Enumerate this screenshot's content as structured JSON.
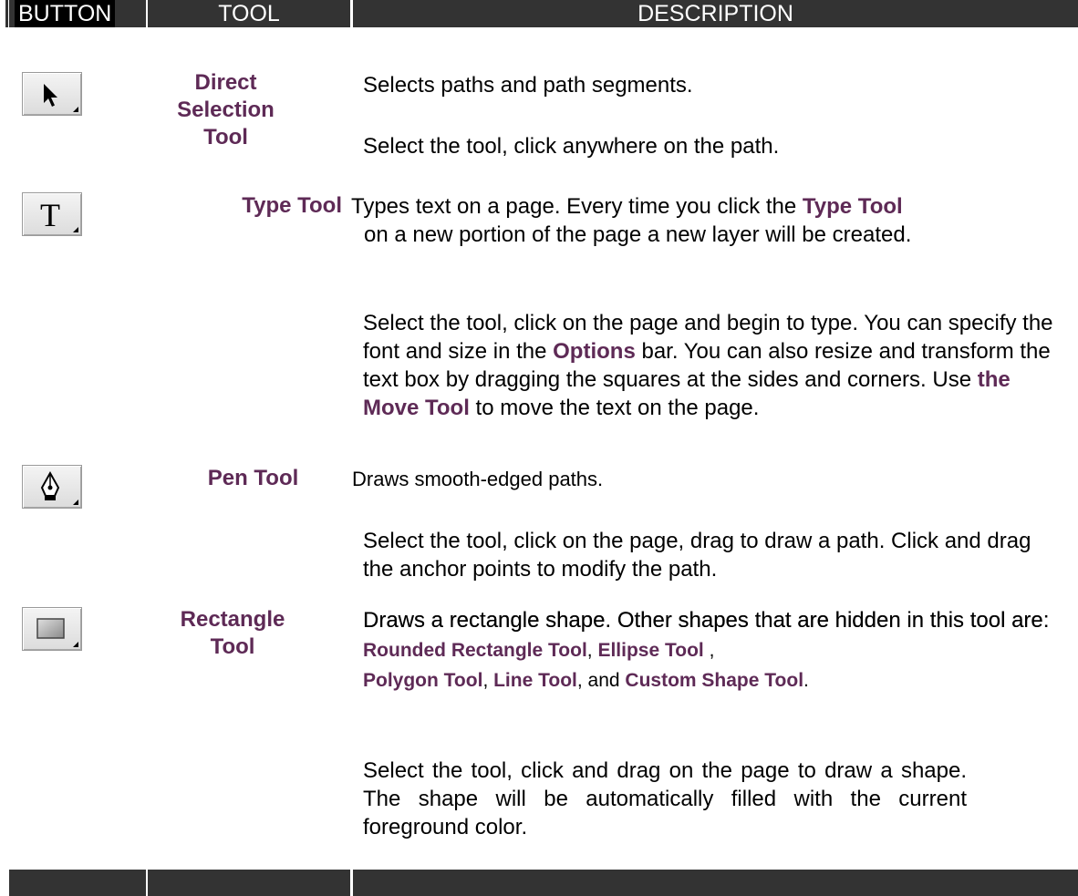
{
  "header": {
    "button_col": "BUTTON",
    "tool_col": "TOOL",
    "description_col": "DESCRIPTION"
  },
  "colors": {
    "header_bg": "#333333",
    "tool_name": "#5e2a56"
  },
  "tools": [
    {
      "icon": "direct-selection-arrow-icon",
      "name_lines": [
        "Direct",
        "Selection",
        "Tool"
      ],
      "description": "Selects paths and path segments.",
      "usage": "Select the tool, click anywhere on the path."
    },
    {
      "icon": "type-t-icon",
      "name": "Type Tool",
      "description_parts": [
        "Types text on a page. Every time you click the ",
        "Type Tool",
        " on a new portion of the page a new layer will be created."
      ],
      "usage_parts": [
        "Select the tool, click on the page and begin to type. You can specify the font and size in the ",
        "Options",
        " bar. You can also resize and transform the text box by dragging the squares at the sides and corners. Use ",
        "the Move Tool",
        " to move the text on the page."
      ]
    },
    {
      "icon": "pen-nib-icon",
      "name": "Pen Tool",
      "description": "Draws smooth-edged paths.",
      "usage": "Select the tool, click on the page, drag to draw a path. Click and drag the anchor points to modify the path."
    },
    {
      "icon": "rectangle-shape-icon",
      "name_lines": [
        "Rectangle",
        "Tool"
      ],
      "description_parts": [
        "Draws a rectangle shape. Other shapes that are hidden in this tool are: ",
        "Rounded Rectangle Tool",
        ", ",
        "Ellipse Tool",
        " , ",
        "Polygon Tool",
        ", ",
        "Line Tool",
        ", and ",
        "Custom Shape Tool",
        "."
      ],
      "usage": "Select the tool, click and drag on the page to draw a shape. The shape will be automatically filled with the current foreground color."
    }
  ]
}
